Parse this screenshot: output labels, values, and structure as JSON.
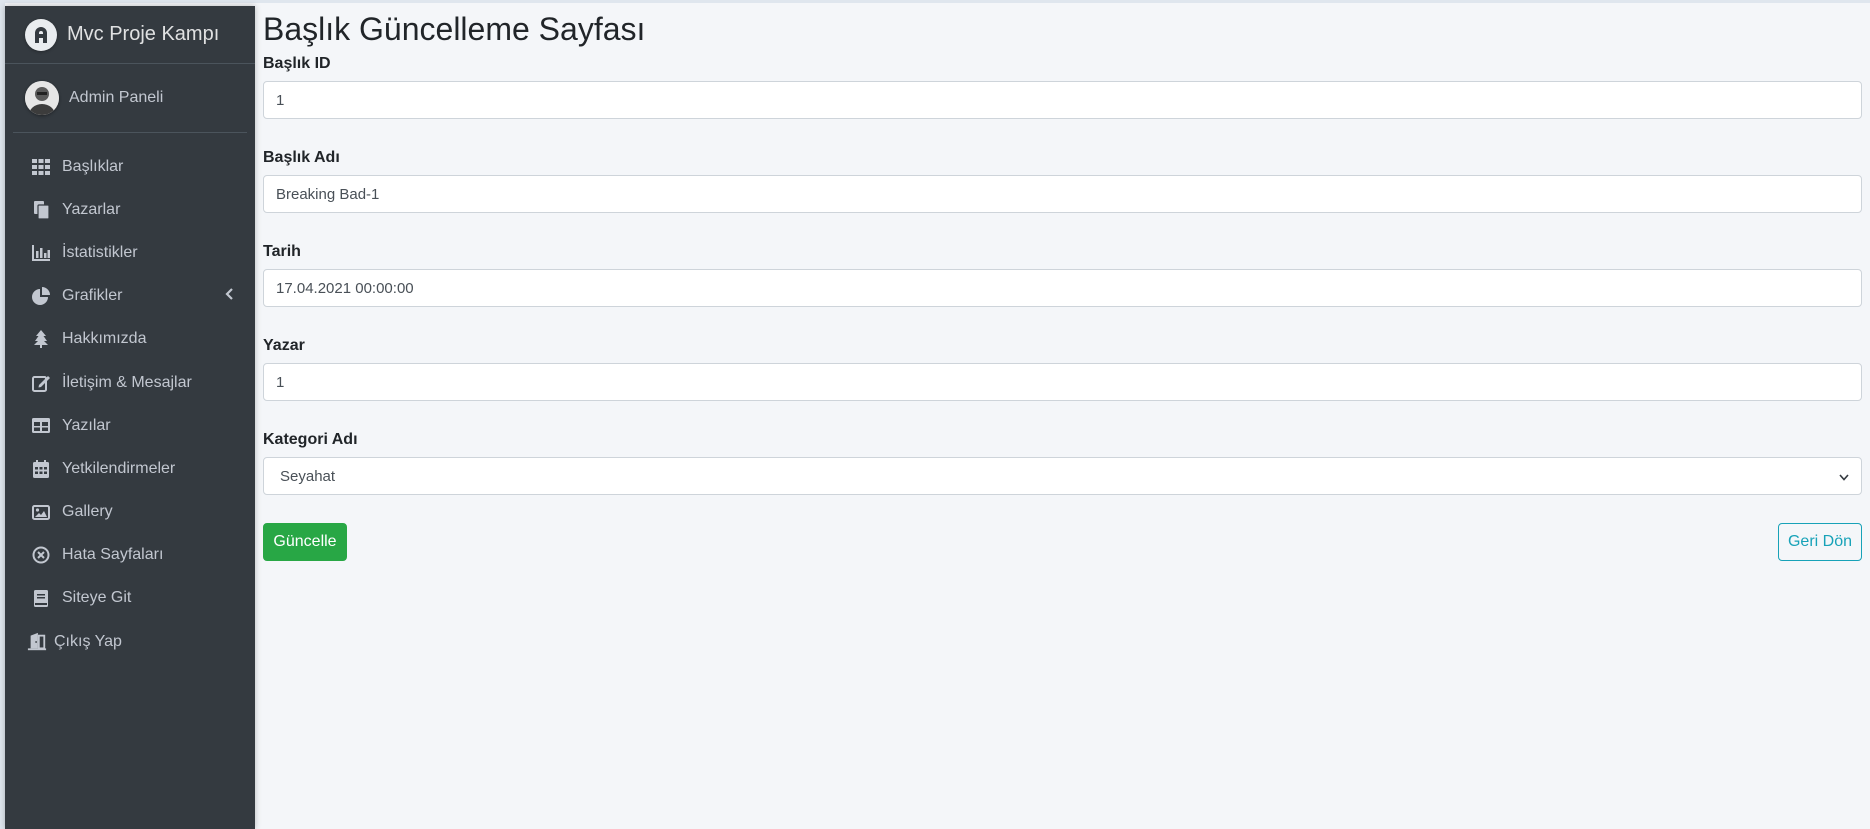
{
  "sidebar": {
    "brand": "Mvc Proje Kampı",
    "user": "Admin Paneli",
    "items": [
      {
        "label": "Başlıklar",
        "icon": "grid-icon"
      },
      {
        "label": "Yazarlar",
        "icon": "copy-icon"
      },
      {
        "label": "İstatistikler",
        "icon": "bar-chart-icon"
      },
      {
        "label": "Grafikler",
        "icon": "pie-chart-icon"
      },
      {
        "label": "Hakkımızda",
        "icon": "tree-icon"
      },
      {
        "label": "İletişim & Mesajlar",
        "icon": "edit-icon"
      },
      {
        "label": "Yazılar",
        "icon": "table-icon"
      },
      {
        "label": "Yetkilendirmeler",
        "icon": "calendar-icon"
      },
      {
        "label": "Gallery",
        "icon": "image-icon"
      },
      {
        "label": "Hata Sayfaları",
        "icon": "x-circle-icon"
      },
      {
        "label": "Siteye Git",
        "icon": "book-icon"
      },
      {
        "label": "Çıkış Yap",
        "icon": "door-icon"
      }
    ]
  },
  "main": {
    "title": "Başlık Güncelleme Sayfası",
    "fields": {
      "id": {
        "label": "Başlık ID",
        "value": "1"
      },
      "name": {
        "label": "Başlık Adı",
        "value": "Breaking Bad-1"
      },
      "date": {
        "label": "Tarih",
        "value": "17.04.2021 00:00:00"
      },
      "writer": {
        "label": "Yazar",
        "value": "1"
      },
      "category": {
        "label": "Kategori Adı",
        "value": "Seyahat"
      }
    },
    "update_button": "Güncelle",
    "back_button": "Geri Dön"
  },
  "colors": {
    "sidebar_bg": "#343a40",
    "success": "#28a745",
    "info": "#17a2b8",
    "page_bg": "#f4f6f9"
  }
}
